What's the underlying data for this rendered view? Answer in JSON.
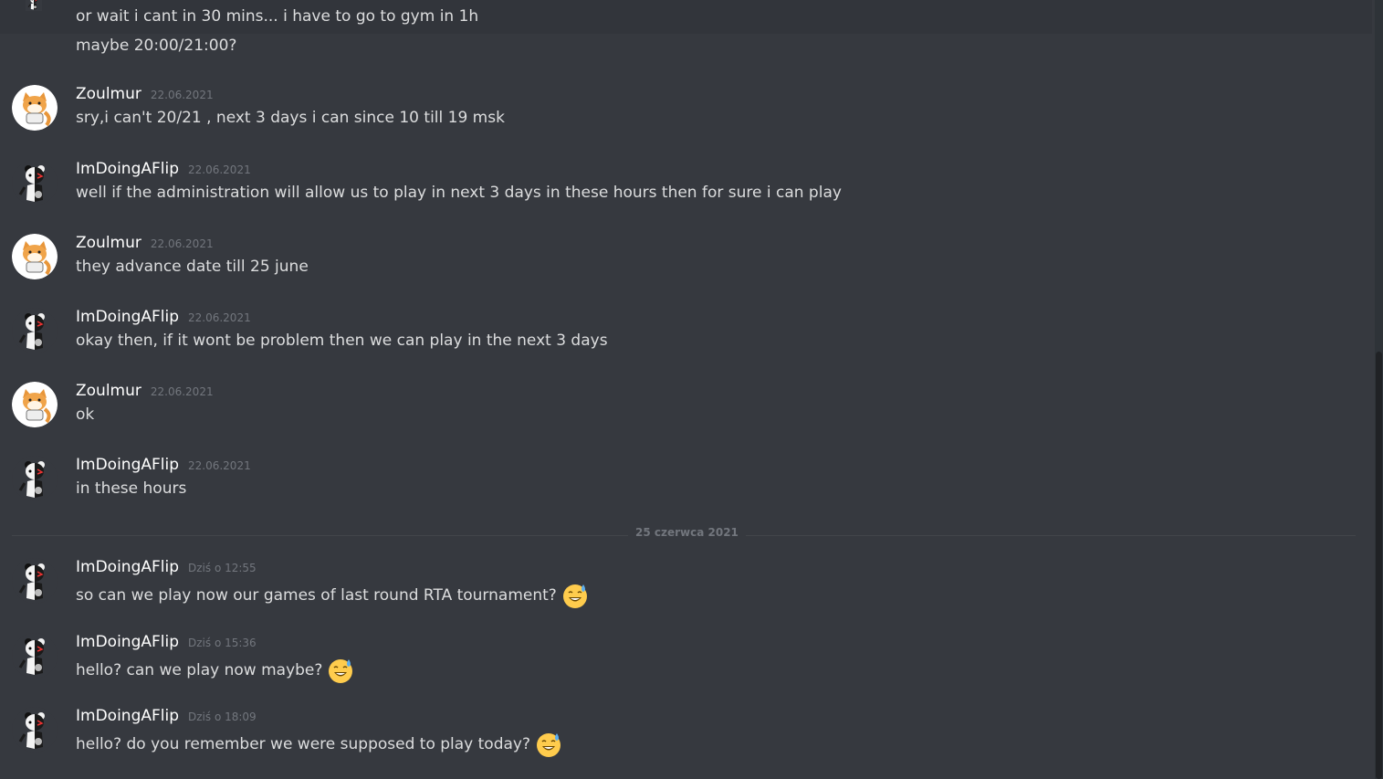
{
  "top": {
    "partial_line": "or wait i cant in 30 mins... i have to go to gym in 1h",
    "continued_line": "maybe 20:00/21:00?"
  },
  "messages": [
    {
      "author": "Zoulmur",
      "time": "22.06.2021",
      "text": "sry,i can't 20/21 , next 3 days i can since 10 till 19 msk",
      "avatar": "fox-avatar"
    },
    {
      "author": "ImDoingAFlip",
      "time": "22.06.2021",
      "text": "well if the administration will allow us to play in next 3 days in these hours then for sure i can play",
      "avatar": "bear-avatar"
    },
    {
      "author": "Zoulmur",
      "time": "22.06.2021",
      "text": "they advance date till 25 june",
      "avatar": "fox-avatar"
    },
    {
      "author": "ImDoingAFlip",
      "time": "22.06.2021",
      "text": "okay then, if it wont be problem then we can play in the next 3 days",
      "avatar": "bear-avatar"
    },
    {
      "author": "Zoulmur",
      "time": "22.06.2021",
      "text": "ok",
      "avatar": "fox-avatar"
    },
    {
      "author": "ImDoingAFlip",
      "time": "22.06.2021",
      "text": "in these hours",
      "avatar": "bear-avatar"
    },
    {
      "author": "ImDoingAFlip",
      "time": "Dziś o 12:55",
      "text": "so can we play now our games of last round RTA tournament?",
      "avatar": "bear-avatar",
      "emoji": "sweat-smile-emoji"
    },
    {
      "author": "ImDoingAFlip",
      "time": "Dziś o 15:36",
      "text": "hello? can we play now maybe?",
      "avatar": "bear-avatar",
      "emoji": "sweat-smile-emoji"
    },
    {
      "author": "ImDoingAFlip",
      "time": "Dziś o 18:09",
      "text": "hello? do you remember we were supposed to play today?",
      "avatar": "bear-avatar",
      "emoji": "sweat-smile-emoji"
    }
  ],
  "date_divider": "25 czerwca 2021",
  "colors": {
    "background": "#36393f",
    "username": "#ffffff",
    "message_text": "#dcddde",
    "timestamp": "#72767d"
  }
}
